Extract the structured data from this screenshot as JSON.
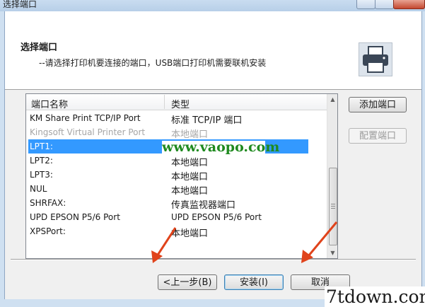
{
  "window": {
    "title": "选择端口"
  },
  "header": {
    "title": "选择端口",
    "subtitle": "--请选择打印机要连接的端口，USB端口打印机需要联机安装",
    "icon": "printer-icon"
  },
  "list": {
    "columns": [
      "端口名称",
      "类型"
    ],
    "rows": [
      {
        "name": "KM Share Print TCP/IP Port",
        "type": "标准 TCP/IP 端口",
        "state": "normal"
      },
      {
        "name": "Kingsoft Virtual Printer Port",
        "type": "本地端口",
        "state": "disabled"
      },
      {
        "name": "LPT1:",
        "type": "",
        "state": "selected"
      },
      {
        "name": "LPT2:",
        "type": "本地端口",
        "state": "normal"
      },
      {
        "name": "LPT3:",
        "type": "本地端口",
        "state": "normal"
      },
      {
        "name": "NUL",
        "type": "本地端口",
        "state": "normal"
      },
      {
        "name": "SHRFAX:",
        "type": "传真监视器端口",
        "state": "normal"
      },
      {
        "name": "UPD EPSON P5/6 Port",
        "type": "UPD EPSON P5/6 Port",
        "state": "normal"
      },
      {
        "name": "XPSPort:",
        "type": "本地端口",
        "state": "normal"
      }
    ]
  },
  "side_buttons": {
    "add": "添加端口",
    "config": "配置端口"
  },
  "footer": {
    "back": "<上一步(B)",
    "install": "安装(I)",
    "cancel": "取消"
  },
  "watermarks": {
    "center": "www.vaopo.com",
    "corner": "7tdown.com"
  },
  "colors": {
    "selection": "#3399ff",
    "arrow": "#e0431b",
    "watermark_green": "#1f8a1f"
  }
}
